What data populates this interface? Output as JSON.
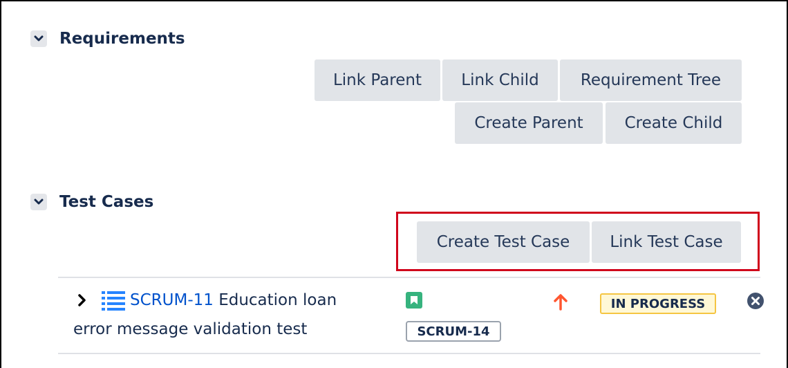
{
  "requirements": {
    "title": "Requirements",
    "buttons": {
      "link_parent": "Link Parent",
      "link_child": "Link Child",
      "requirement_tree": "Requirement Tree",
      "create_parent": "Create Parent",
      "create_child": "Create Child"
    }
  },
  "test_cases": {
    "title": "Test Cases",
    "buttons": {
      "create_test_case": "Create Test Case",
      "link_test_case": "Link Test Case"
    },
    "rows": [
      {
        "key": "SCRUM-11",
        "summary_line1": "Education loan",
        "summary_line2": "error message validation test",
        "linked_key": "SCRUM-14",
        "status": "IN PROGRESS",
        "icons": {
          "expand": "chevron-right-icon",
          "type": "test-list-icon",
          "epic": "bookmark-icon",
          "priority": "priority-high-arrow-icon",
          "remove": "remove-circle-icon"
        }
      }
    ]
  },
  "colors": {
    "link": "#0052cc",
    "highlight": "#d0021b",
    "status_border": "#f5c542",
    "priority": "#ff5630",
    "epic": "#36b37e"
  }
}
